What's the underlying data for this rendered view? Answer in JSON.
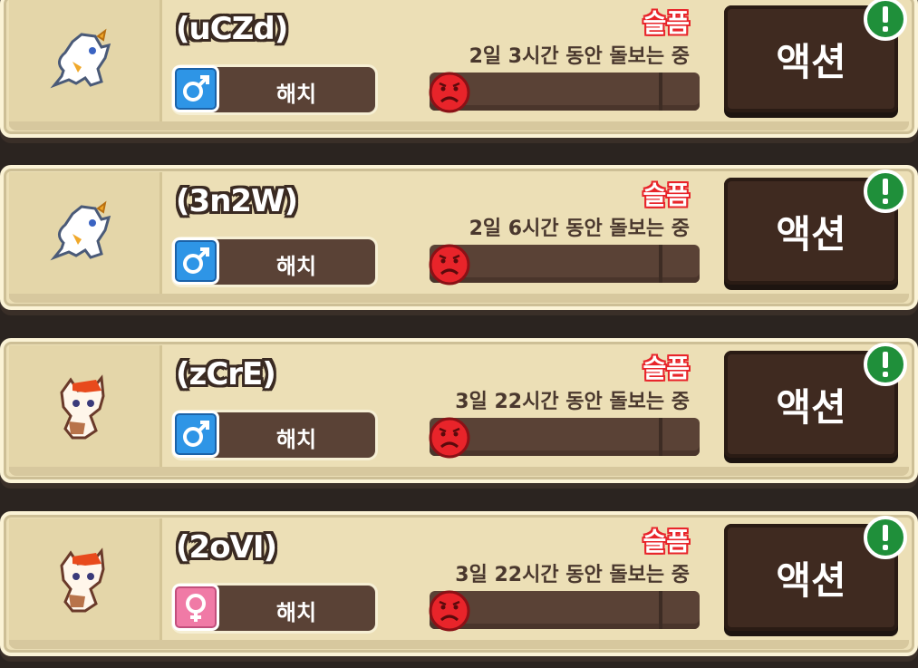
{
  "pets": [
    {
      "name": "(uCZd)",
      "gender": "male",
      "gender_icon": "male-icon",
      "stage": "해치",
      "mood": "슬픔",
      "care_time": "2일 3시간 동안 돌보는 중",
      "happiness": 0.0,
      "action_label": "액션",
      "creature": "white-dragon"
    },
    {
      "name": "(3n2W)",
      "gender": "male",
      "gender_icon": "male-icon",
      "stage": "해치",
      "mood": "슬픔",
      "care_time": "2일 6시간 동안 돌보는 중",
      "happiness": 0.0,
      "action_label": "액션",
      "creature": "white-dragon"
    },
    {
      "name": "(zCrE)",
      "gender": "male",
      "gender_icon": "male-icon",
      "stage": "해치",
      "mood": "슬픔",
      "care_time": "3일 22시간 동안 돌보는 중",
      "happiness": 0.0,
      "action_label": "액션",
      "creature": "fox-cat"
    },
    {
      "name": "(2oVI)",
      "gender": "female",
      "gender_icon": "female-icon",
      "stage": "해치",
      "mood": "슬픔",
      "care_time": "3일 22시간 동안 돌보는 중",
      "happiness": 0.0,
      "action_label": "액션",
      "creature": "fox-cat"
    }
  ],
  "colors": {
    "mood_sad": "#e8242a",
    "male": "#2e95e6",
    "female": "#f07aa6",
    "alert": "#1f8f3a"
  }
}
